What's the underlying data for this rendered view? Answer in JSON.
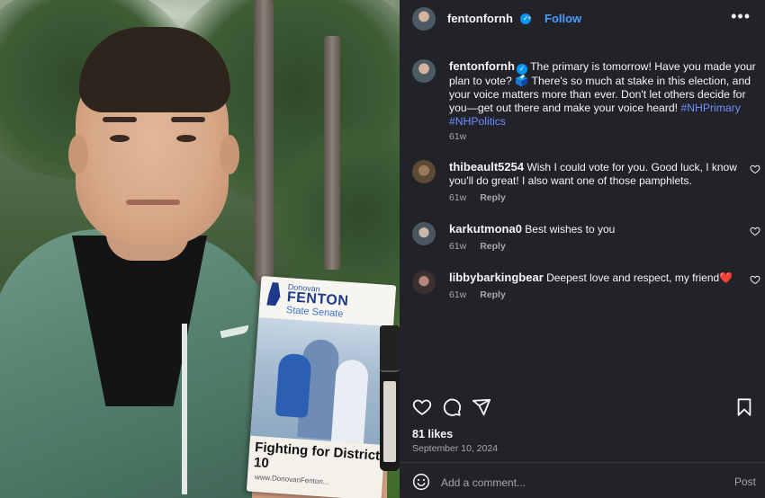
{
  "accent_color": "#0095f6",
  "hashtag_color": "#6f8dff",
  "panel_bg": "#212328",
  "photo": {
    "pamphlet": {
      "first_name": "Donovan",
      "last_name": "FENTON",
      "office": "State Senate",
      "slogan": "Fighting for District 10",
      "url": "www.DonovanFenton..."
    }
  },
  "header": {
    "username": "fentonfornh",
    "separator": "•",
    "follow_label": "Follow",
    "more_icon": "more-horizontal-icon"
  },
  "post": {
    "username": "fentonfornh",
    "caption_text": "The primary is tomorrow! Have you made your plan to vote? 🗳️ There's so much at stake in this election, and your voice matters more than ever. Don't let others decide for you—get out there and make your voice heard!",
    "hashtags": [
      "#NHPrimary",
      "#NHPolitics"
    ],
    "time": "61w"
  },
  "comments": [
    {
      "username": "thibeault5254",
      "text": "Wish I could vote for you. Good luck, I know you'll do great! I also want one of those pamphlets.",
      "time": "61w",
      "reply_label": "Reply"
    },
    {
      "username": "karkutmona0",
      "text": "Best wishes to you",
      "time": "61w",
      "reply_label": "Reply"
    },
    {
      "username": "libbybarkingbear",
      "text": "Deepest love and respect, my friend❤️",
      "time": "61w",
      "reply_label": "Reply"
    }
  ],
  "actions": {
    "like_icon": "heart-icon",
    "comment_icon": "comment-icon",
    "share_icon": "share-icon",
    "save_icon": "bookmark-icon"
  },
  "likes_label": "81 likes",
  "date": "September 10, 2024",
  "comment_box": {
    "emoji_icon": "emoji-icon",
    "placeholder": "Add a comment...",
    "post_label": "Post"
  }
}
